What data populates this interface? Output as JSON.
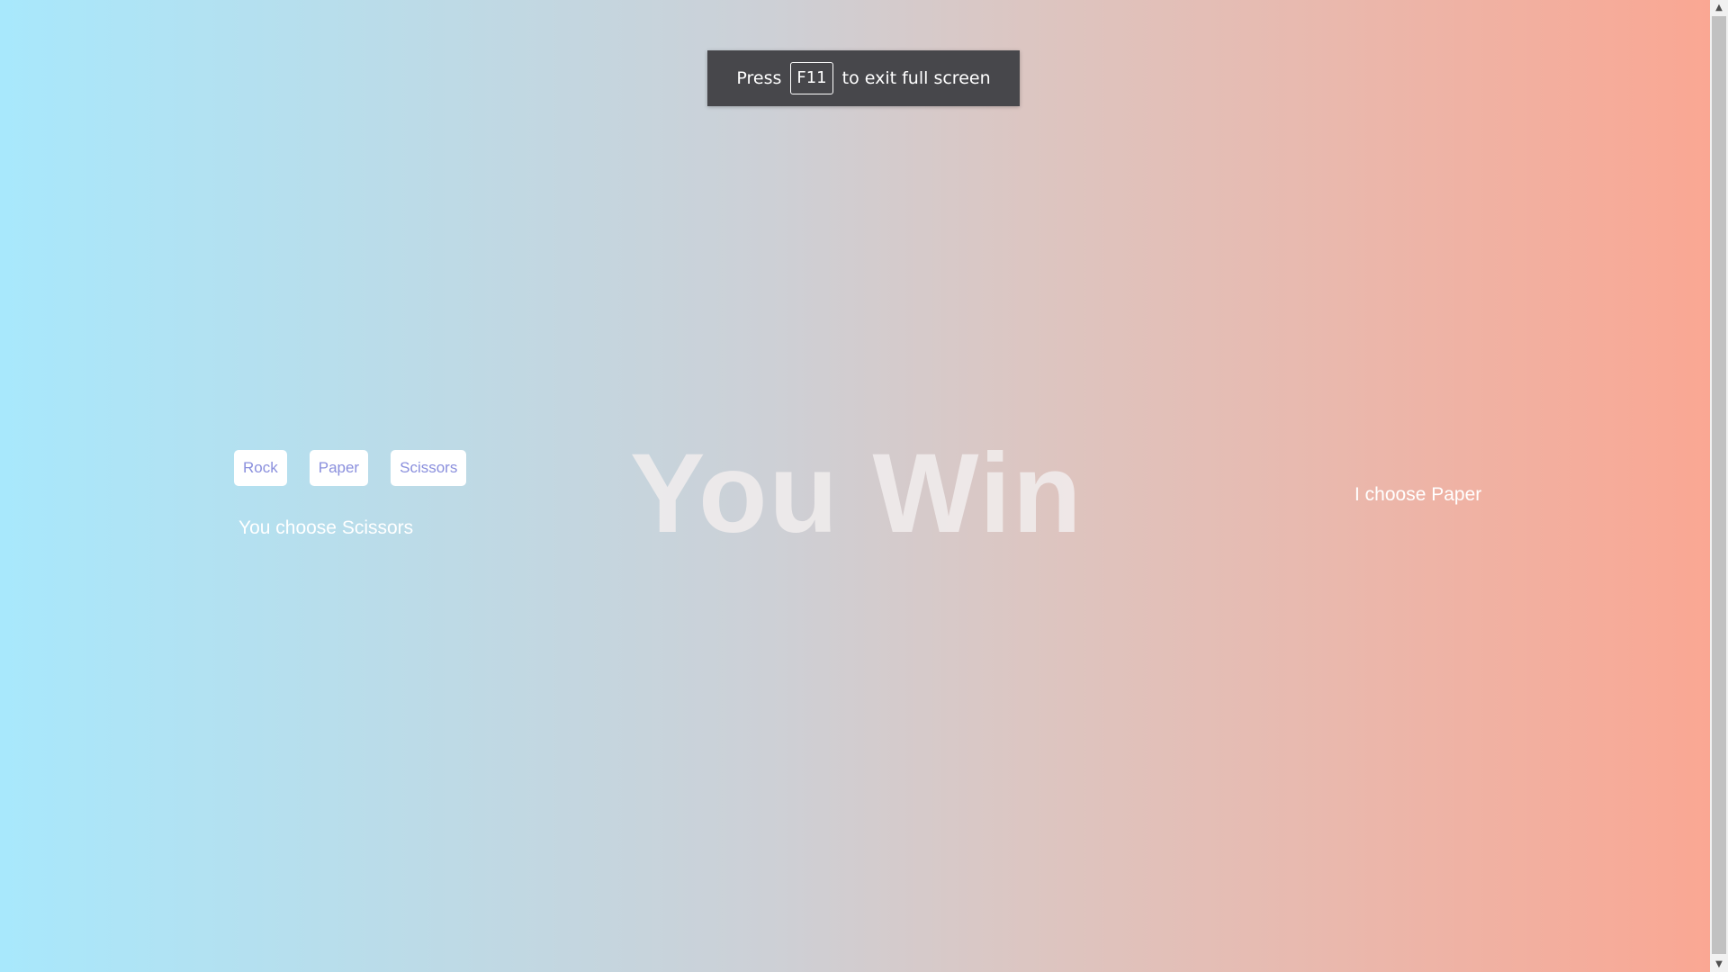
{
  "fullscreen_toast": {
    "prefix": "Press",
    "key": "F11",
    "suffix": "to exit full screen"
  },
  "game": {
    "buttons": {
      "rock": "Rock",
      "paper": "Paper",
      "scissors": "Scissors"
    },
    "user_choice_text": "You choose Scissors",
    "computer_choice_text": "I choose Paper",
    "result_text": "You Win"
  },
  "colors": {
    "gradient_left": "#a8e8fc",
    "gradient_right": "#faa793",
    "button_text": "#8a8fdd"
  },
  "icons": {
    "scroll_up": "triangle-up-icon",
    "scroll_down": "triangle-down-icon"
  }
}
